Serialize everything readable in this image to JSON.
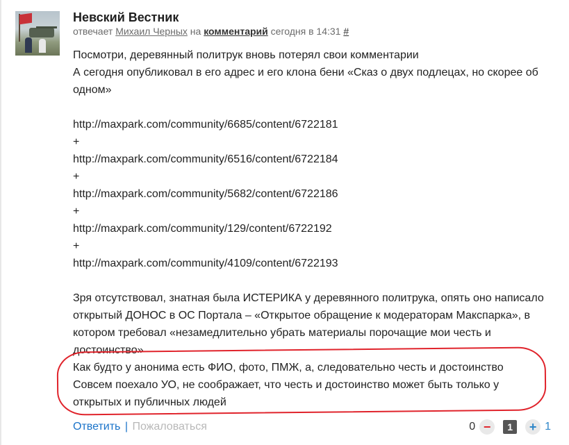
{
  "comment": {
    "author": "Невский Вестник",
    "meta": {
      "replies_prefix": "отвечает",
      "reply_to_user": "Михаил Черных",
      "on_word": "на",
      "comment_link": "комментарий",
      "time": "сегодня в 14:31",
      "permalink": "#"
    },
    "lines": [
      "Посмотри, деревянный политрук вновь потерял свои комментарии",
      "А сегодня опубликовал в его адрес и его клона бени «Сказ о двух подлецах, но скорее об одном»",
      "",
      "http://maxpark.com/community/6685/content/6722181",
      "+",
      "http://maxpark.com/community/6516/content/6722184",
      "+",
      "http://maxpark.com/community/5682/content/6722186",
      "+",
      "http://maxpark.com/community/129/content/6722192",
      "+",
      "http://maxpark.com/community/4109/content/6722193",
      "",
      "Зря отсутствовал, знатная была ИСТЕРИКА у деревянного политрука, опять оно написало открытый ДОНОС в ОС Портала – «Открытое обращение к модераторам Макспарка», в котором требовал «незамедлительно убрать материалы порочащие мои честь и достоинство»",
      "Как будто у анонима есть ФИО, фото, ПМЖ, а, следовательно честь и достоинство Совсем поехало УО, не соображает, что честь и достоинство может быть только у открытых и публичных людей"
    ],
    "actions": {
      "reply": "Ответить",
      "separator": "|",
      "complain": "Пожаловаться"
    },
    "votes": {
      "negative_count": "0",
      "minus_symbol": "−",
      "rating": "1",
      "plus_symbol": "+",
      "positive_count": "1"
    },
    "colors": {
      "link": "#1a73c9",
      "highlight": "#e0232b",
      "minus": "#e0242c",
      "plus": "#2e86c8"
    }
  }
}
